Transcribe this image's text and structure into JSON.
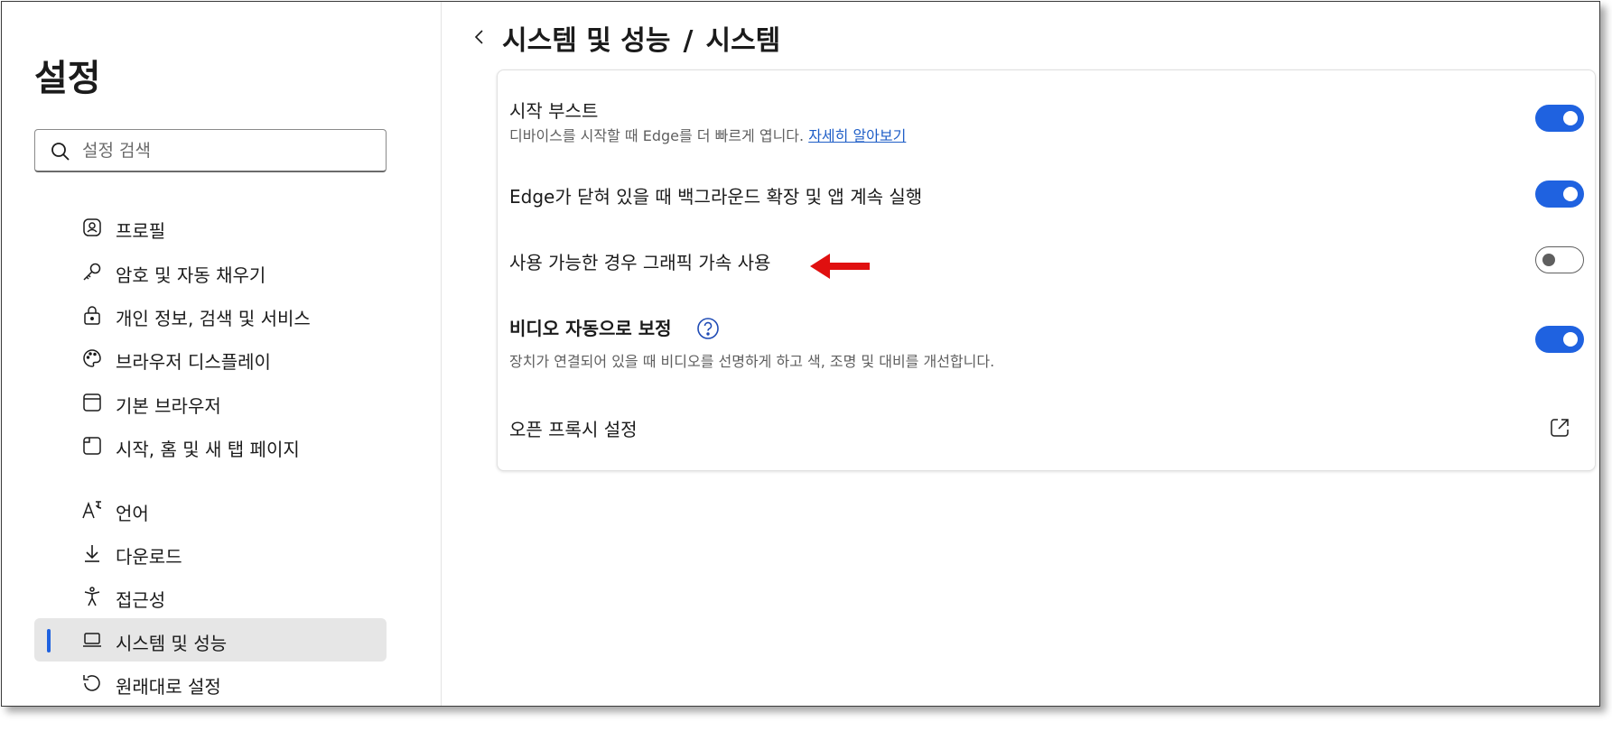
{
  "sidebar": {
    "title": "설정",
    "search": {
      "placeholder": "설정 검색",
      "value": ""
    },
    "items": [
      {
        "label": "프로필",
        "icon": "profile-icon"
      },
      {
        "label": "암호 및 자동 채우기",
        "icon": "key-icon"
      },
      {
        "label": "개인 정보, 검색 및 서비스",
        "icon": "lock-icon"
      },
      {
        "label": "브라우저 디스플레이",
        "icon": "palette-icon"
      },
      {
        "label": "기본 브라우저",
        "icon": "browser-window-icon"
      },
      {
        "label": "시작, 홈 및 새 탭 페이지",
        "icon": "tab-page-icon"
      },
      {
        "label": "언어",
        "icon": "language-icon"
      },
      {
        "label": "다운로드",
        "icon": "download-icon"
      },
      {
        "label": "접근성",
        "icon": "accessibility-icon"
      },
      {
        "label": "시스템 및 성능",
        "icon": "laptop-icon",
        "active": true
      },
      {
        "label": "원래대로 설정",
        "icon": "reset-icon"
      }
    ]
  },
  "header": {
    "parent": "시스템 및 성능",
    "separator": "/",
    "current": "시스템"
  },
  "settings": {
    "startup_boost": {
      "title": "시작 부스트",
      "desc": "디바이스를 시작할 때 Edge를 더 빠르게 엽니다.",
      "link": "자세히 알아보기",
      "enabled": true
    },
    "background": {
      "title": "Edge가 닫혀 있을 때 백그라운드 확장 및 앱 계속 실행",
      "enabled": true
    },
    "graphics": {
      "title": "사용 가능한 경우 그래픽 가속 사용",
      "enabled": false
    },
    "video": {
      "title": "비디오 자동으로 보정",
      "desc": "장치가 연결되어 있을 때 비디오를 선명하게 하고 색, 조명 및 대비를 개선합니다.",
      "enabled": true
    },
    "proxy": {
      "title": "오픈 프록시 설정"
    }
  },
  "colors": {
    "accent": "#1f62e0",
    "annotation_arrow": "#e01010",
    "active_nav_bg": "#e6e6e6"
  }
}
